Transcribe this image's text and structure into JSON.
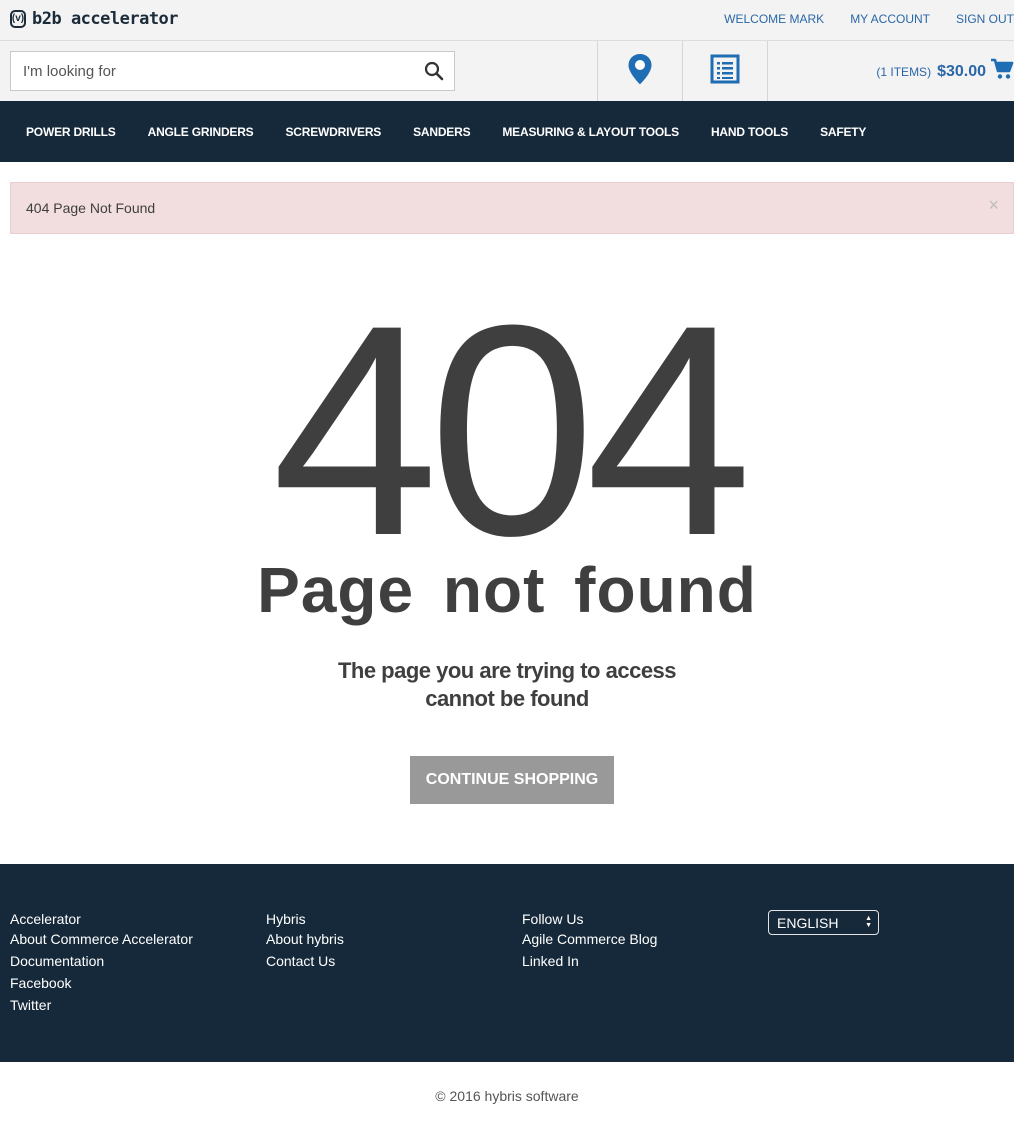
{
  "header": {
    "logo_mark": "(v)",
    "logo_text": "b2b accelerator",
    "welcome": "WELCOME MARK",
    "my_account": "MY ACCOUNT",
    "sign_out": "SIGN OUT"
  },
  "search": {
    "placeholder": "I'm looking for"
  },
  "cart": {
    "items_text": "(1 ITEMS)",
    "total": "$30.00"
  },
  "nav": {
    "items": [
      "POWER DRILLS",
      "ANGLE GRINDERS",
      "SCREWDRIVERS",
      "SANDERS",
      "MEASURING & LAYOUT TOOLS",
      "HAND TOOLS",
      "SAFETY"
    ]
  },
  "alert": {
    "message": "404 Page Not Found",
    "close": "×"
  },
  "error": {
    "code": "404",
    "title": "Page not  found",
    "line1": "The page you are trying to access",
    "line2": "cannot be found",
    "button": "CONTINUE SHOPPING"
  },
  "footer": {
    "col1": {
      "heading": "Accelerator",
      "links": [
        "About Commerce Accelerator",
        "Documentation",
        "Facebook",
        "Twitter"
      ]
    },
    "col2": {
      "heading": "Hybris",
      "links": [
        "About hybris",
        "Contact Us"
      ]
    },
    "col3": {
      "heading": "Follow Us",
      "links": [
        "Agile Commerce Blog",
        "Linked In"
      ]
    },
    "language": "ENGLISH",
    "copyright": "© 2016 hybris software"
  },
  "colors": {
    "navy": "#16293a",
    "link_blue": "#2a67a8",
    "icon_blue": "#1f6db3",
    "alert_bg": "#f2dede",
    "button_gray": "#999999"
  },
  "icons": [
    "search-icon",
    "location-pin-icon",
    "order-form-icon",
    "cart-icon",
    "close-icon",
    "select-arrows-icon"
  ]
}
